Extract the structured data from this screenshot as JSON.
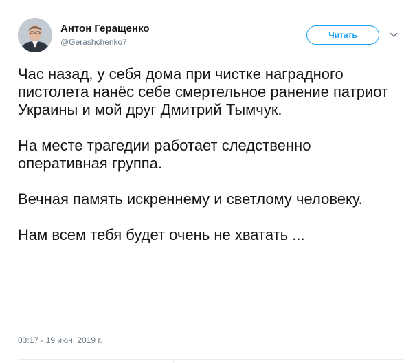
{
  "user": {
    "display_name": "Антон Геращенко",
    "handle": "@Gerashchenko7"
  },
  "actions": {
    "follow_label": "Читать",
    "menu_icon": "chevron-down-icon"
  },
  "tweet": {
    "paragraphs": [
      "Час назад, у себя дома при чистке наградного пистолета нанёс себе смертельное ранение патриот Украины и мой друг Дмитрий Тымчук.",
      "На месте трагедии работает следственно оперативная группа.",
      "Вечная память искреннему и светлому человеку.",
      "Нам всем тебя будет очень не хватать ..."
    ],
    "timestamp": "03:17 - 19 июн. 2019 г."
  },
  "colors": {
    "accent": "#1da1f2",
    "text": "#14171a",
    "muted": "#657786",
    "divider": "#e6ecf0"
  }
}
